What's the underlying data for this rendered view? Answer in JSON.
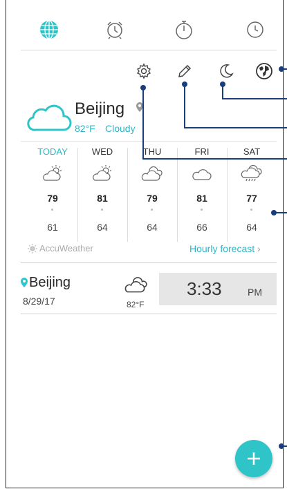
{
  "tabs": [
    {
      "name": "world-clock",
      "icon": "globe-icon",
      "active": true
    },
    {
      "name": "alarm",
      "icon": "alarm-clock-icon",
      "active": false
    },
    {
      "name": "stopwatch",
      "icon": "stopwatch-icon",
      "active": false
    },
    {
      "name": "timer",
      "icon": "timer-icon",
      "active": false
    }
  ],
  "toolbar": {
    "items": [
      {
        "name": "settings",
        "icon": "gear-icon"
      },
      {
        "name": "edit",
        "icon": "pencil-icon"
      },
      {
        "name": "night-mode",
        "icon": "moon-icon"
      },
      {
        "name": "add-city",
        "icon": "earth-icon"
      }
    ]
  },
  "weather": {
    "city": "Beijing",
    "temp": "82°F",
    "condition": "Cloudy",
    "provider": "AccuWeather",
    "hourly_label": "Hourly forecast",
    "days": [
      {
        "name": "TODAY",
        "icon": "partly-cloudy-icon",
        "high": "79",
        "low": "61",
        "today": true
      },
      {
        "name": "WED",
        "icon": "partly-cloudy-icon",
        "high": "81",
        "low": "64",
        "today": false
      },
      {
        "name": "THU",
        "icon": "cloudy-icon",
        "high": "79",
        "low": "64",
        "today": false
      },
      {
        "name": "FRI",
        "icon": "cloud-icon",
        "high": "81",
        "low": "66",
        "today": false
      },
      {
        "name": "SAT",
        "icon": "rain-icon",
        "high": "77",
        "low": "64",
        "today": false
      }
    ]
  },
  "clock": {
    "city": "Beijing",
    "date": "8/29/17",
    "temp": "82°F",
    "time": "3:33",
    "ampm": "PM"
  },
  "fab": {
    "icon": "plus-icon"
  },
  "colors": {
    "accent": "#2ab7c7",
    "callout": "#1a3d7c",
    "fab": "#2ec4c8"
  }
}
